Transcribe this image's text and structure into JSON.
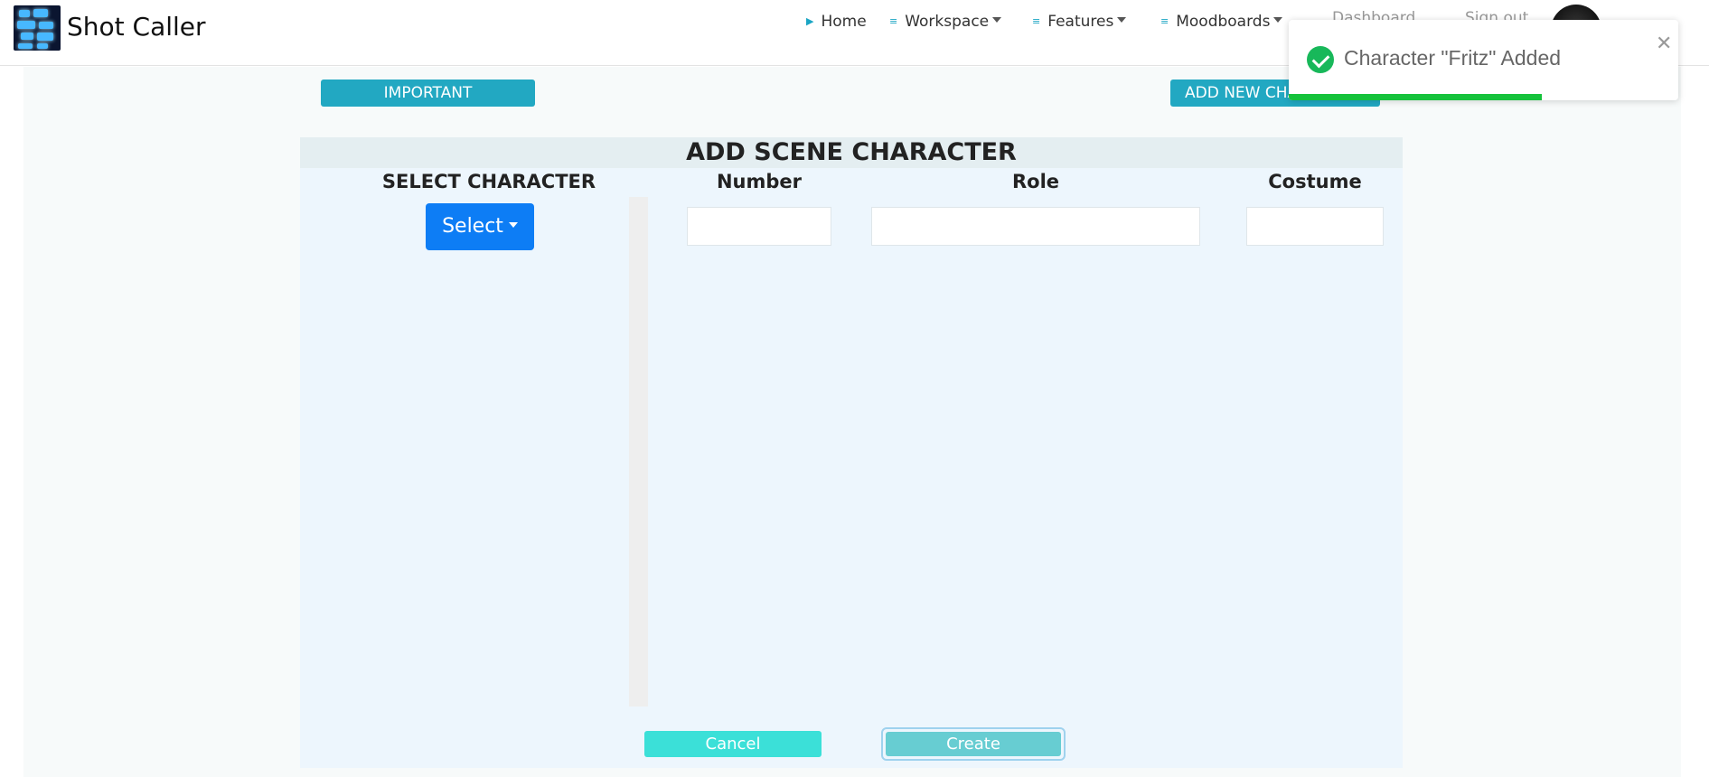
{
  "app": {
    "title": "Shot Caller"
  },
  "nav": {
    "items": [
      {
        "label": "Home",
        "icon": "play-icon",
        "dropdown": false
      },
      {
        "label": "Workspace",
        "icon": "list-icon",
        "dropdown": true
      },
      {
        "label": "Features",
        "icon": "list-icon",
        "dropdown": true
      },
      {
        "label": "Moodboards",
        "icon": "list-icon",
        "dropdown": true
      }
    ],
    "faded_left": "Dashboard",
    "faded_right": "Sign out"
  },
  "top_buttons": {
    "important": "IMPORTANT",
    "add_new": "ADD NEW CHARACTER"
  },
  "form": {
    "title": "ADD SCENE CHARACTER",
    "columns": {
      "select_character": "SELECT CHARACTER",
      "number": "Number",
      "role": "Role",
      "costume": "Costume"
    },
    "select_label": "Select",
    "fields": {
      "number": "",
      "role": "",
      "costume": ""
    },
    "cancel_label": "Cancel",
    "create_label": "Create"
  },
  "toast": {
    "message": "Character \"Fritz\" Added",
    "close_glyph": "✕",
    "progress_fraction": 0.65,
    "color": "#15c23b"
  },
  "colors": {
    "accent": "#22a8c2",
    "select_button": "#0d7df5",
    "cancel_button": "#3be0d8",
    "create_button": "#67cdd2"
  }
}
